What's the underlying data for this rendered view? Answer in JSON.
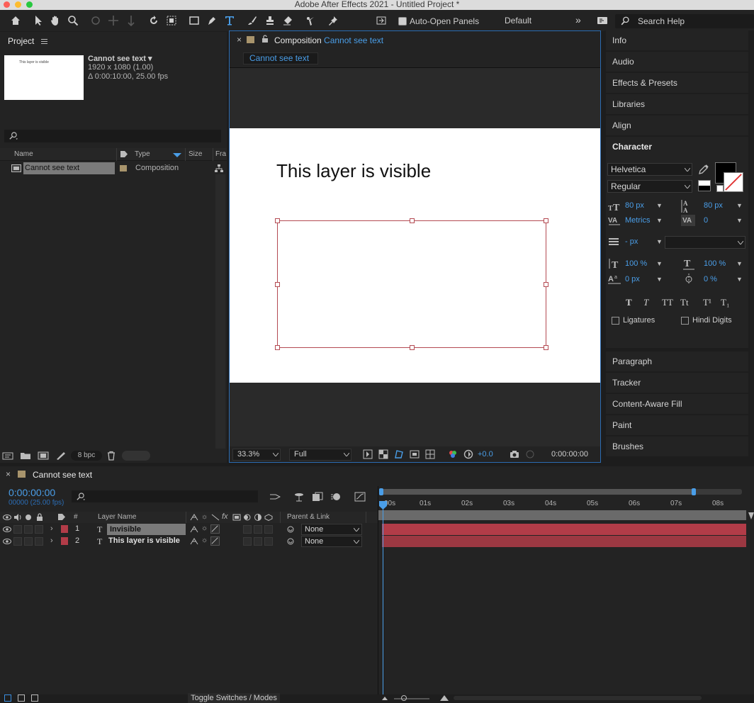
{
  "window": {
    "title": "Adobe After Effects 2021 - Untitled Project *"
  },
  "toolbar": {
    "auto_open_label": "Auto-Open Panels",
    "workspace": "Default",
    "search_placeholder": "Search Help"
  },
  "project": {
    "panel_title": "Project",
    "thumb_text": "This layer is visible",
    "comp_name": "Cannot see text ▾",
    "comp_res": "1920 x 1080 (1.00)",
    "comp_dur": "Δ 0:00:10:00, 25.00 fps",
    "columns": {
      "name": "Name",
      "type": "Type",
      "size": "Size",
      "frame": "Fra"
    },
    "items": [
      {
        "name": "Cannot see text",
        "type": "Composition"
      }
    ],
    "bpc": "8 bpc"
  },
  "composition": {
    "tab_prefix": "Composition",
    "tab_name": "Cannot see text",
    "breadcrumb": "Cannot see text",
    "visible_text": "This layer is visible",
    "zoom": "33.3%",
    "resolution": "Full",
    "exposure": "+0.0",
    "timecode": "0:00:00:00"
  },
  "right_panels": {
    "top": [
      "Info",
      "Audio",
      "Effects & Presets",
      "Libraries",
      "Align"
    ],
    "bottom": [
      "Paragraph",
      "Tracker",
      "Content-Aware Fill",
      "Paint",
      "Brushes"
    ]
  },
  "character": {
    "title": "Character",
    "font": "Helvetica",
    "style": "Regular",
    "font_size": "80 px",
    "leading": "80 px",
    "kerning": "Metrics",
    "tracking": "0",
    "stroke_width": "- px",
    "vscale": "100 %",
    "hscale": "100 %",
    "baseline": "0 px",
    "tsume": "0 %",
    "styles": [
      "T",
      "T",
      "TT",
      "Tt",
      "T¹",
      "T₁"
    ],
    "ligatures": "Ligatures",
    "hindi_digits": "Hindi Digits"
  },
  "timeline": {
    "tab_name": "Cannot see text",
    "timecode": "0:00:00:00",
    "frames": "00000 (25.00 fps)",
    "col_num": "#",
    "col_layer": "Layer Name",
    "col_parent": "Parent & Link",
    "ruler": [
      "00s",
      "01s",
      "02s",
      "03s",
      "04s",
      "05s",
      "06s",
      "07s",
      "08s"
    ],
    "layers": [
      {
        "num": "1",
        "name": "Invisible",
        "parent": "None"
      },
      {
        "num": "2",
        "name": "This layer is visible",
        "parent": "None"
      }
    ],
    "toggle_label": "Toggle Switches / Modes"
  },
  "colors": {
    "accent": "#4a9ee8",
    "layer_label": "#b23c48",
    "selection": "#8c3a3e"
  }
}
